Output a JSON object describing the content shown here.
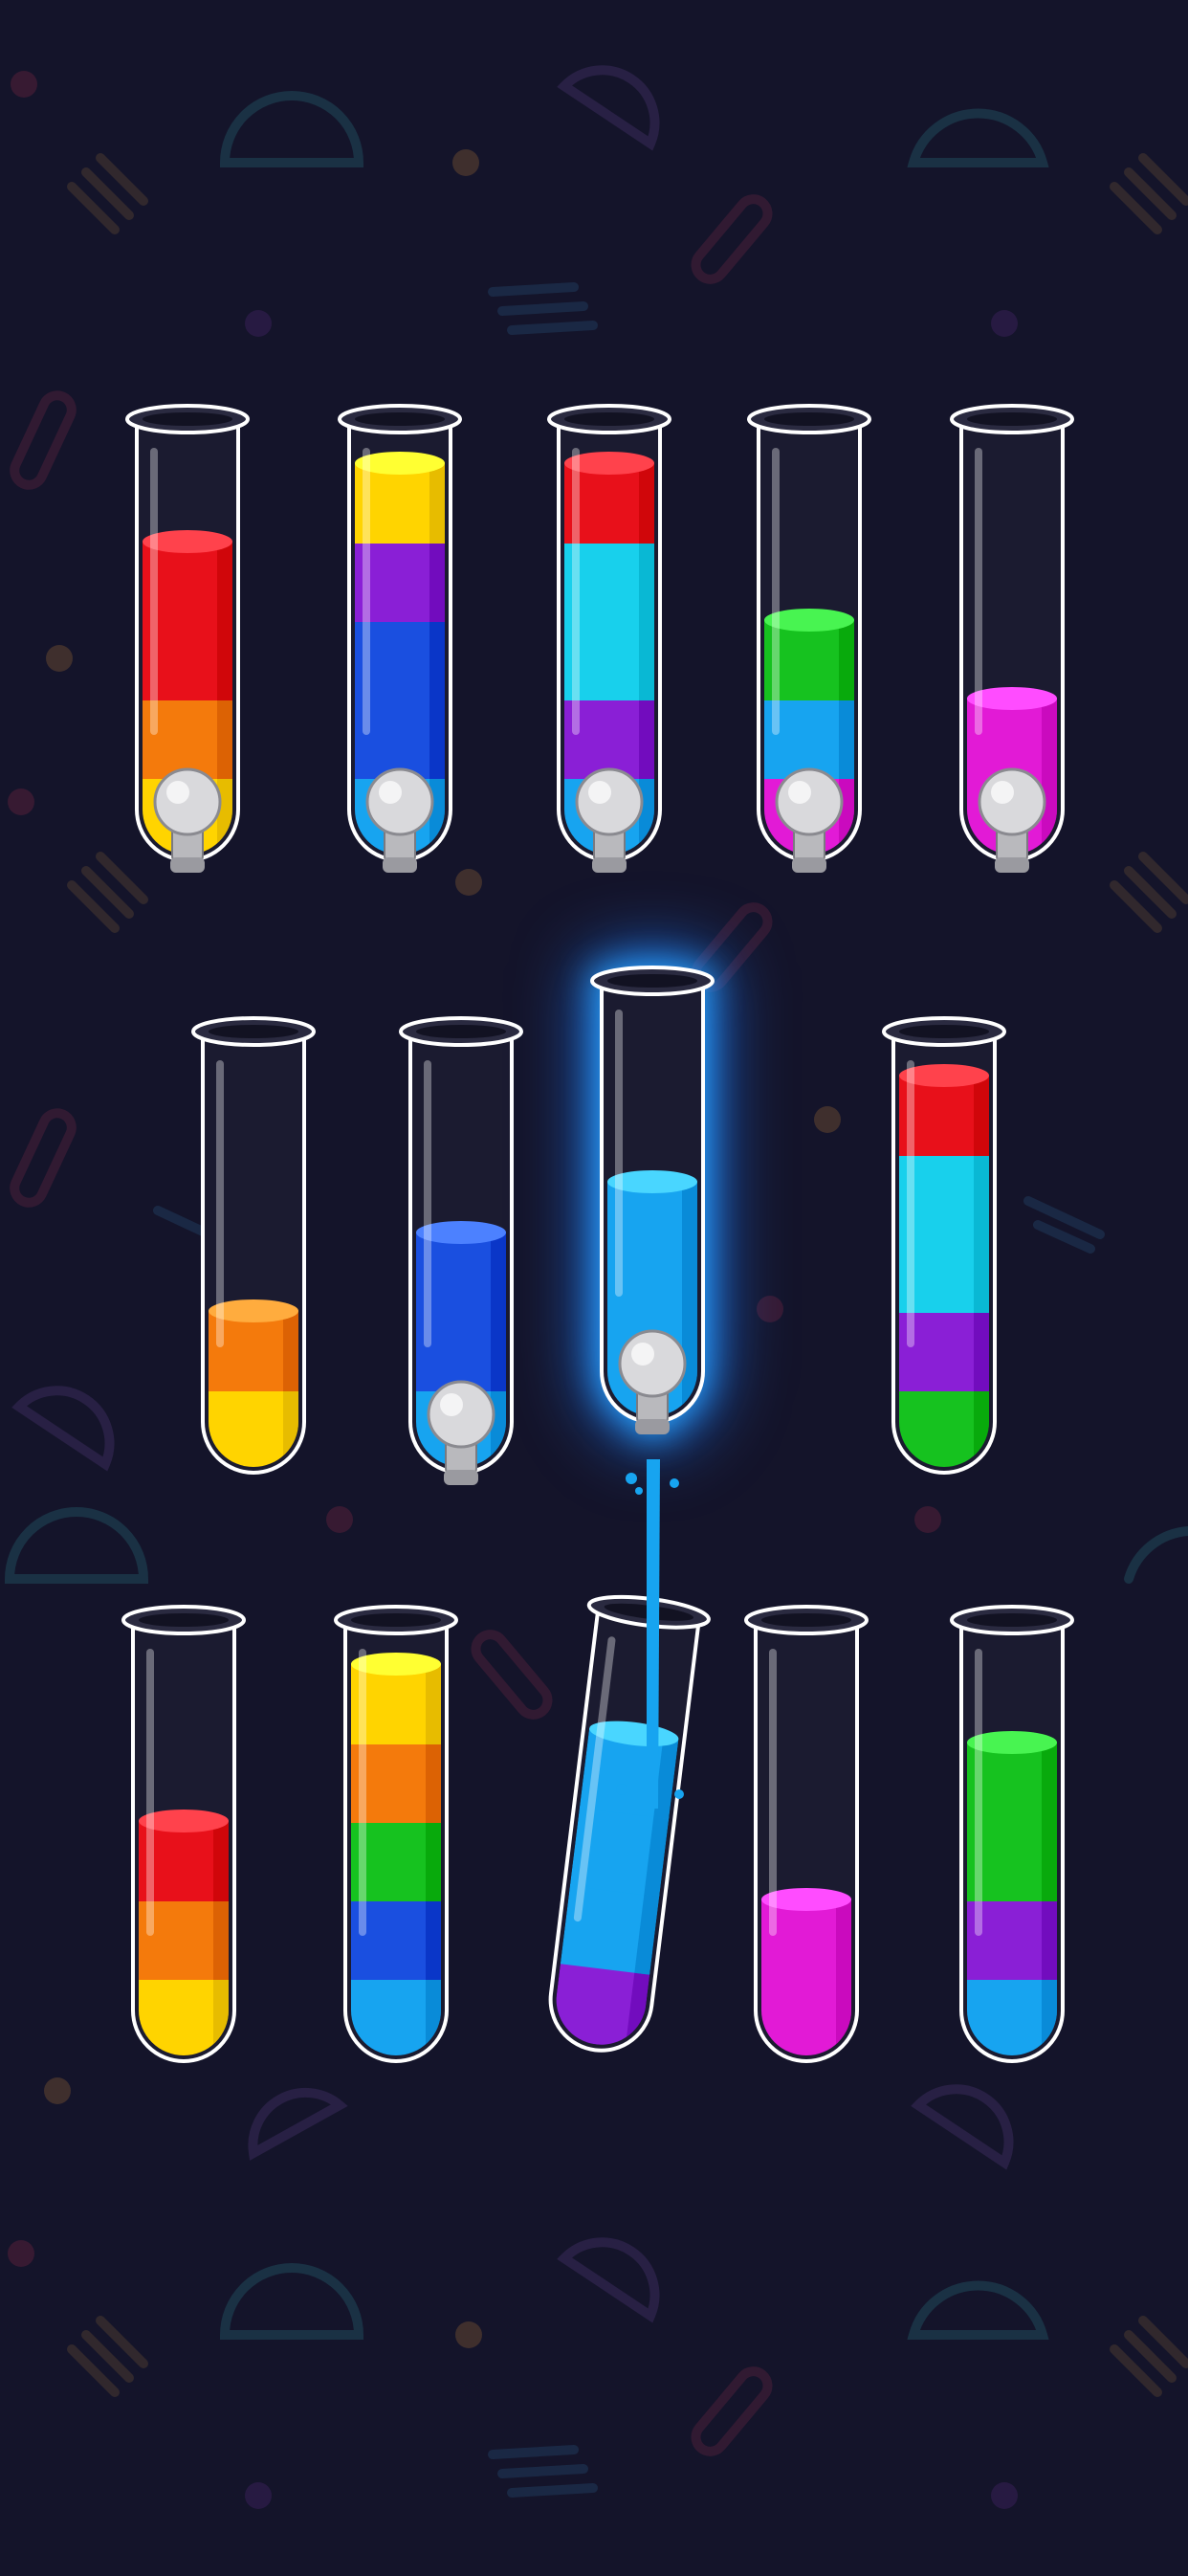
{
  "colors": {
    "background": "#14142a",
    "red": "#e8101a",
    "orange": "#f47a0c",
    "yellow": "#ffd400",
    "purple": "#8a1fd6",
    "blue": "#1a4fe0",
    "lightblue": "#17a4f0",
    "cyan": "#18d0ec",
    "green": "#16c21f",
    "magenta": "#e21ad6",
    "glow": "#2aa9ff"
  },
  "icons": {
    "tap": "tap-valve-icon",
    "stream": "pouring-stream"
  },
  "tubes": [
    {
      "id": "r1c1",
      "layers": [
        "yellow",
        "orange",
        "red",
        "red"
      ],
      "tap": true
    },
    {
      "id": "r1c2",
      "layers": [
        "lightblue",
        "blue",
        "blue",
        "purple",
        "yellow"
      ],
      "tap": true
    },
    {
      "id": "r1c3",
      "layers": [
        "lightblue",
        "purple",
        "cyan",
        "cyan",
        "red"
      ],
      "tap": true
    },
    {
      "id": "r1c4",
      "layers": [
        "magenta",
        "lightblue",
        "green"
      ],
      "tap": true
    },
    {
      "id": "r1c5",
      "layers": [
        "magenta",
        "magenta"
      ],
      "tap": true
    },
    {
      "id": "r2c1",
      "layers": [
        "yellow",
        "orange"
      ],
      "tap": false
    },
    {
      "id": "r2c2",
      "layers": [
        "lightblue",
        "blue",
        "blue"
      ],
      "tap": true
    },
    {
      "id": "r2c3",
      "layers": [
        "lightblue",
        "lightblue",
        "lightblue"
      ],
      "tap": true,
      "selected": true
    },
    {
      "id": "r2c4",
      "layers": [
        "green",
        "purple",
        "cyan",
        "cyan",
        "red"
      ],
      "tap": false
    },
    {
      "id": "r3c1",
      "layers": [
        "yellow",
        "orange",
        "red"
      ],
      "tap": false
    },
    {
      "id": "r3c2",
      "layers": [
        "lightblue",
        "blue",
        "green",
        "orange",
        "yellow"
      ],
      "tap": false
    },
    {
      "id": "r3c3",
      "layers": [
        "purple",
        "lightblue",
        "lightblue",
        "lightblue"
      ],
      "tap": false,
      "tilted": true,
      "receiving": true
    },
    {
      "id": "r3c4",
      "layers": [
        "magenta",
        "magenta"
      ],
      "tap": false
    },
    {
      "id": "r3c5",
      "layers": [
        "lightblue",
        "purple",
        "green",
        "green"
      ],
      "tap": false
    }
  ]
}
